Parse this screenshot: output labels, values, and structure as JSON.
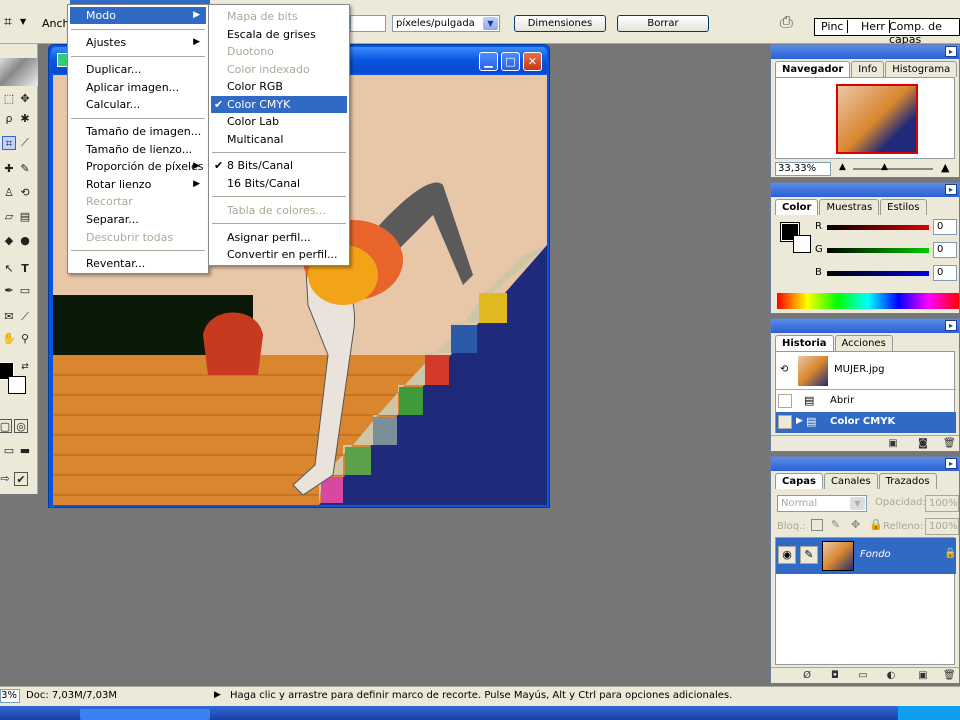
{
  "options_bar": {
    "width_label": "Anch",
    "resolution_unit": "píxeles/pulgada",
    "dimensions_button": "Dimensiones",
    "clear_button": "Borrar",
    "well_tabs": [
      "Pinc",
      "Herr",
      "Comp. de capas"
    ]
  },
  "image_menu": {
    "title": "Modo",
    "items": [
      {
        "label": "Ajustes",
        "submenu": true
      },
      {
        "label": "Duplicar..."
      },
      {
        "label": "Aplicar imagen..."
      },
      {
        "label": "Calcular..."
      },
      {
        "label": "Tamaño de imagen..."
      },
      {
        "label": "Tamaño de lienzo..."
      },
      {
        "label": "Proporción de píxeles",
        "submenu": true
      },
      {
        "label": "Rotar lienzo",
        "submenu": true
      },
      {
        "label": "Recortar",
        "disabled": true
      },
      {
        "label": "Separar..."
      },
      {
        "label": "Descubrir todas",
        "disabled": true
      },
      {
        "label": "Reventar..."
      }
    ]
  },
  "mode_submenu": {
    "items": [
      {
        "label": "Mapa de bits",
        "disabled": true
      },
      {
        "label": "Escala de grises"
      },
      {
        "label": "Duotono",
        "disabled": true
      },
      {
        "label": "Color indexado",
        "disabled": true
      },
      {
        "label": "Color RGB"
      },
      {
        "label": "Color CMYK",
        "checked": true,
        "highlighted": true
      },
      {
        "label": "Color Lab"
      },
      {
        "label": "Multicanal"
      },
      {
        "label": "8 Bits/Canal",
        "checked": true
      },
      {
        "label": "16 Bits/Canal"
      },
      {
        "label": "Tabla de colores...",
        "disabled": true
      },
      {
        "label": "Asignar perfil..."
      },
      {
        "label": "Convertir en perfil..."
      }
    ]
  },
  "document": {
    "min_button": "▁",
    "max_button": "□",
    "close_button": "✕"
  },
  "navigator": {
    "tabs": [
      "Navegador",
      "Info",
      "Histograma"
    ],
    "zoom": "33,33%"
  },
  "color": {
    "tabs": [
      "Color",
      "Muestras",
      "Estilos"
    ],
    "channels": [
      {
        "name": "R",
        "value": "0",
        "color": "#c00000"
      },
      {
        "name": "G",
        "value": "0",
        "color": "#00c000"
      },
      {
        "name": "B",
        "value": "0",
        "color": "#0000c0"
      }
    ]
  },
  "history": {
    "tabs": [
      "Historia",
      "Acciones"
    ],
    "snapshot": "MUJER.jpg",
    "steps": [
      {
        "label": "Abrir"
      },
      {
        "label": "Color CMYK",
        "active": true
      }
    ]
  },
  "layers": {
    "tabs": [
      "Capas",
      "Canales",
      "Trazados"
    ],
    "blend_mode": "Normal",
    "opacity_label": "Opacidad:",
    "opacity": "100%",
    "lock_label": "Bloq.:",
    "fill_label": "Relleno:",
    "fill": "100%",
    "layer_name": "Fondo"
  },
  "status": {
    "zoom": "3%",
    "doc": "Doc: 7,03M/7,03M",
    "hint": "Haga clic y arrastre para definir marco de recorte. Pulse Mayús, Alt y Ctrl para opciones adicionales."
  },
  "colors": {
    "accent": "#316ac5",
    "xp_title": "#0a55e0",
    "panel_bg": "#ece9d8"
  }
}
